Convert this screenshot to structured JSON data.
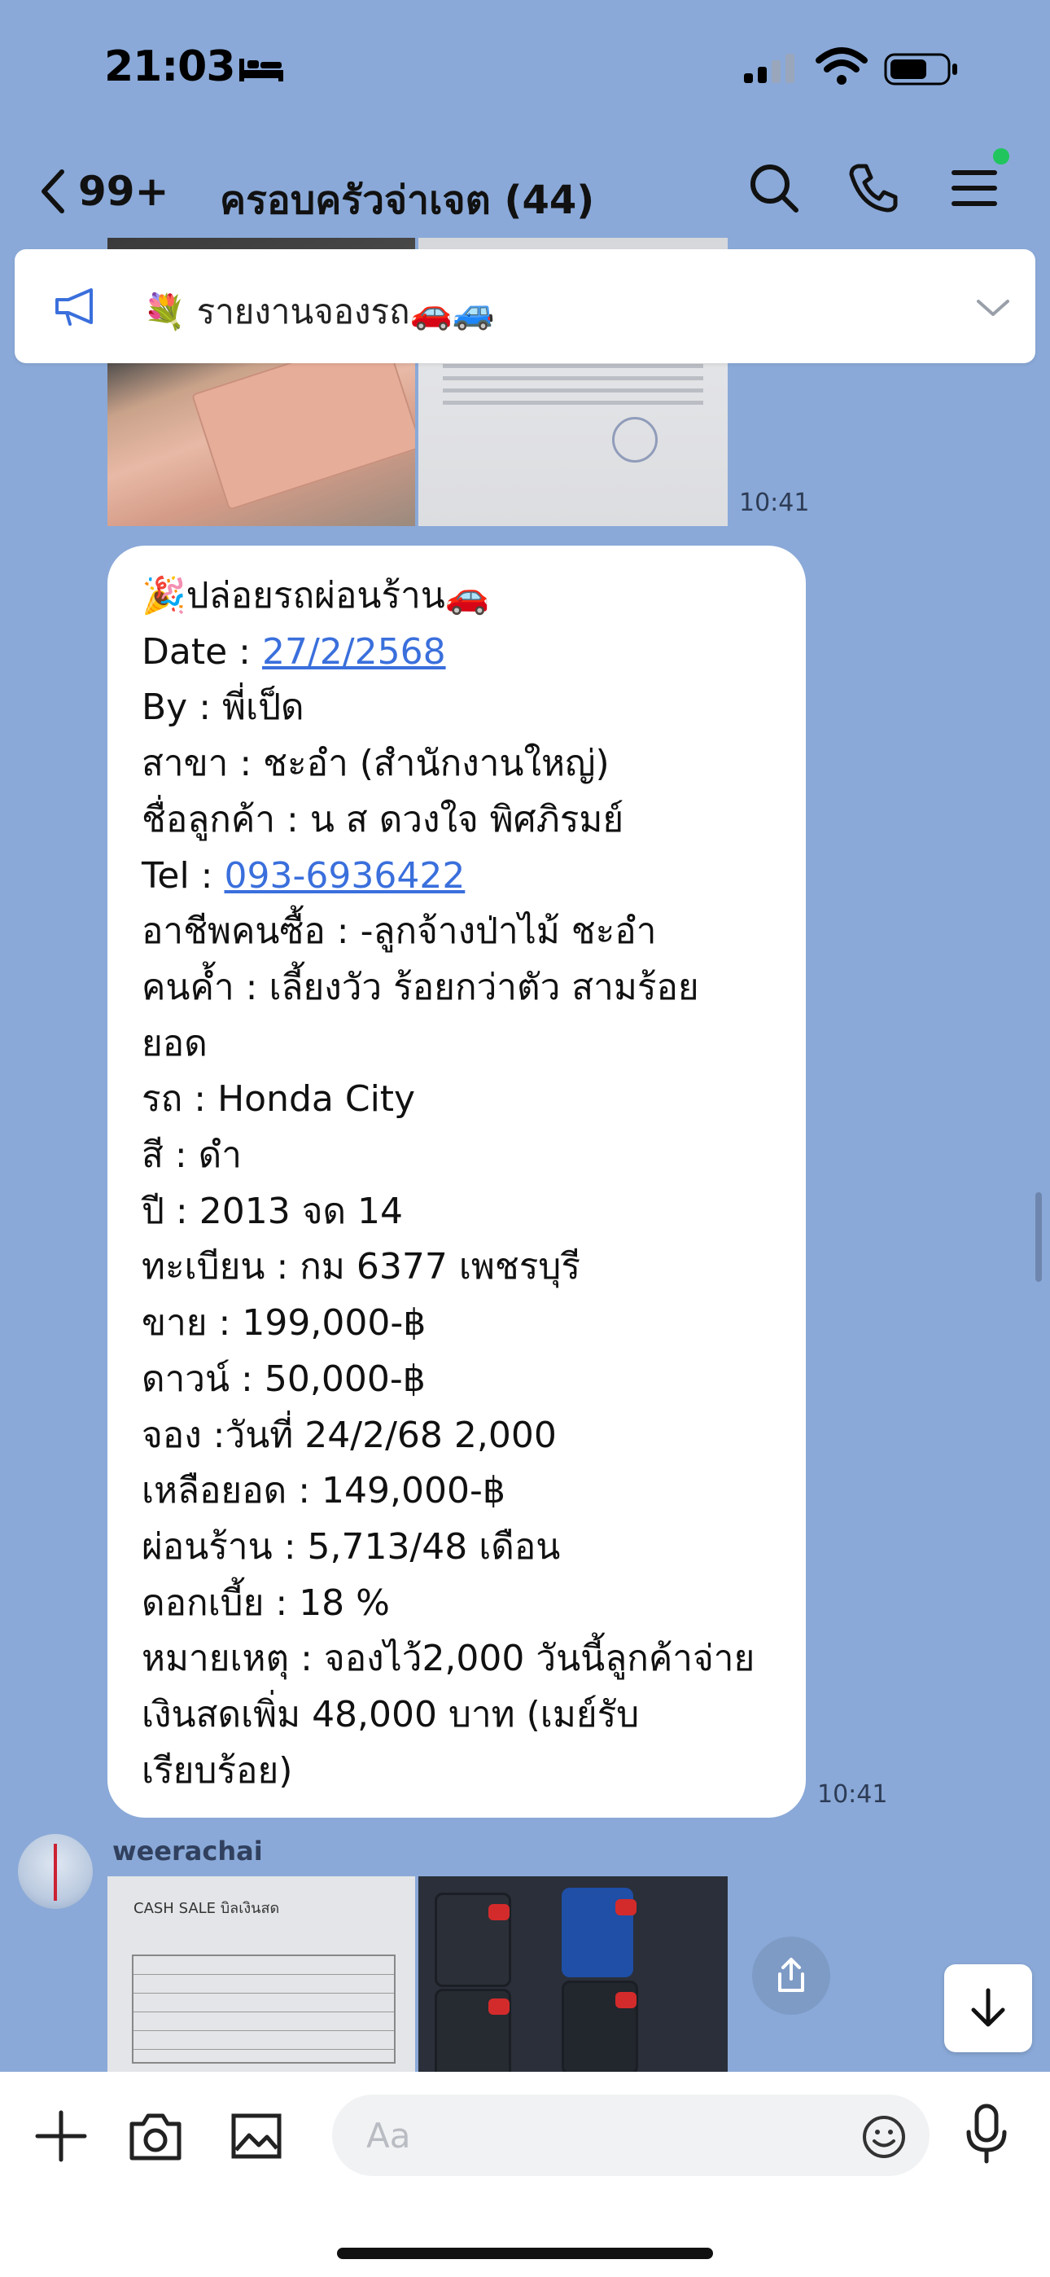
{
  "status_bar": {
    "time": "21:03",
    "icons": [
      "bed-icon",
      "signal-icon",
      "wifi-icon",
      "battery-icon"
    ]
  },
  "header": {
    "back_count": "99+",
    "title": "ครอบครัวจ่าเจต (44)",
    "icons": [
      "search-icon",
      "phone-icon",
      "menu-icon"
    ],
    "accent": "#20c55e"
  },
  "announcement": {
    "text": "💐 รายงานจองรถ🚗🚙"
  },
  "messages": {
    "photo_time": "10:41",
    "text_time": "10:41",
    "bubble_lines": [
      "🎉ปล่อยรถผ่อนร้าน🚗",
      "Date : ",
      "By : พี่เป็ด",
      "สาขา : ชะอำ (สำนักงานใหญ่)",
      "ชื่อลูกค้า : น ส ดวงใจ พิศภิรมย์",
      "Tel : ",
      "อาชีพคนซื้อ : -ลูกจ้างป่าไม้ ชะอำ",
      "คนค้ำ : เลี้ยงวัว ร้อยกว่าตัว สามร้อย",
      "ยอด",
      "รถ : Honda City",
      "สี : ดำ",
      "ปี : 2013 จด 14",
      "ทะเบียน : กม 6377 เพชรบุรี",
      "ขาย : 199,000-฿",
      "ดาวน์ : 50,000-฿",
      "จอง :วันที่ 24/2/68  2,000",
      "เหลือยอด : 149,000-฿",
      "ผ่อนร้าน : 5,713/48 เดือน",
      "ดอกเบี้ย : 18 %",
      "หมายเหตุ : จองไว้2,000 วันนี้ลูกค้าจ่าย",
      "เงินสดเพิ่ม 48,000 บาท (เมย์รับ",
      "เรียบร้อย)"
    ],
    "date_link": "27/2/2568",
    "tel_link": "093-6936422",
    "link_color": "#3a6fdc",
    "sender": "weerachai",
    "receipt_header": "CASH SALE     บิลเงินสด"
  },
  "composer": {
    "placeholder": "Aa",
    "icons": [
      "plus-icon",
      "camera-icon",
      "image-icon",
      "emoji-icon",
      "mic-icon"
    ]
  },
  "colors": {
    "background": "#8aa9d8",
    "bubble": "#ffffff"
  }
}
